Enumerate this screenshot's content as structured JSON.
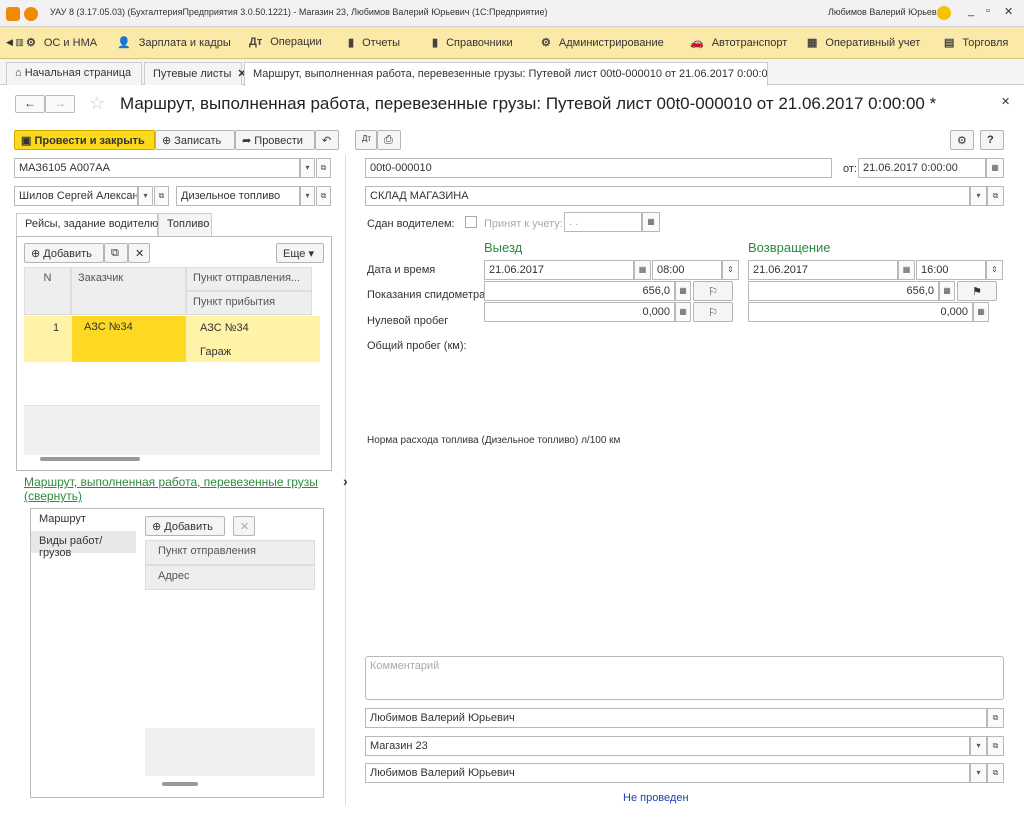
{
  "window": {
    "title": "УАУ 8 (3.17.05.03) (БухгалтерияПредприятия 3.0.50.1221) - Магазин 23, Любимов Валерий Юрьевич (1С:Предприятие)",
    "user": "Любимов Валерий Юрьевич"
  },
  "menu": [
    {
      "icon": "⚙",
      "label": "ОС и НМА"
    },
    {
      "icon": "👤",
      "label": "Зарплата и кадры"
    },
    {
      "icon": "Дт",
      "label": "Операции"
    },
    {
      "icon": "▮",
      "label": "Отчеты"
    },
    {
      "icon": "▮",
      "label": "Справочники"
    },
    {
      "icon": "⚙",
      "label": "Администрирование"
    },
    {
      "icon": "🚗",
      "label": "Автотранспорт"
    },
    {
      "icon": "▦",
      "label": "Оперативный учет"
    },
    {
      "icon": "▤",
      "label": "Торговля"
    }
  ],
  "tabs": {
    "home": "Начальная страница",
    "waybills": "Путевые листы",
    "current": "Маршрут, выполненная работа, перевезенные грузы: Путевой лист 00t0-000010 от 21.06.2017 0:00:00 *"
  },
  "doc_title": "Маршрут, выполненная работа, перевезенные грузы: Путевой лист 00t0-000010 от 21.06.2017 0:00:00 *",
  "toolbar": {
    "post_close": "Провести и закрыть",
    "write": "Записать",
    "post": "Провести",
    "help": "?"
  },
  "left": {
    "vehicle": "МАЗ6105 А007АА",
    "driver": "Шилов Сергей Александ",
    "fuel": "Дизельное топливо",
    "tab_trips": "Рейсы, задание водителю",
    "tab_fuel": "Топливо",
    "add": "Добавить",
    "more": "Еще",
    "col_n": "N",
    "col_customer": "Заказчик",
    "col_from": "Пункт отправления...",
    "col_to": "Пункт прибытия",
    "row": {
      "n": "1",
      "customer": "АЗС №34",
      "from": "АЗС №34",
      "to": "Гараж"
    },
    "link": "Маршрут, выполненная работа, перевезенные грузы (свернуть)",
    "sub_tab_route": "Маршрут",
    "sub_tab_works": "Виды работ/грузов",
    "sub_add": "Добавить",
    "sub_col_from": "Пункт отправления",
    "sub_col_addr": "Адрес"
  },
  "right": {
    "number": "00t0-000010",
    "date_label": "от:",
    "date": "21.06.2017 0:00:00",
    "warehouse": "СКЛАД МАГАЗИНА",
    "handed_label": "Сдан водителем:",
    "accepted_label": "Принят к учету:",
    "accepted_date": " .  .",
    "depart": "Выезд",
    "return": "Возвращение",
    "datetime_label": "Дата и время",
    "dep_date": "21.06.2017",
    "dep_time": "08:00",
    "ret_date": "21.06.2017",
    "ret_time": "16:00",
    "odometer_label": "Показания спидометра",
    "dep_odo": "656,0",
    "ret_odo": "656,0",
    "zero_label": "Нулевой пробег",
    "dep_zero": "0,000",
    "ret_zero": "0,000",
    "total_label": "Общий пробег (км):",
    "norm_label": "Норма расхода топлива (Дизельное топливо) л/100 км",
    "comment_ph": "Комментарий",
    "responsible": "Любимов Валерий Юрьевич",
    "org": "Магазин 23",
    "manager": "Любимов Валерий Юрьевич",
    "status": "Не проведен"
  }
}
